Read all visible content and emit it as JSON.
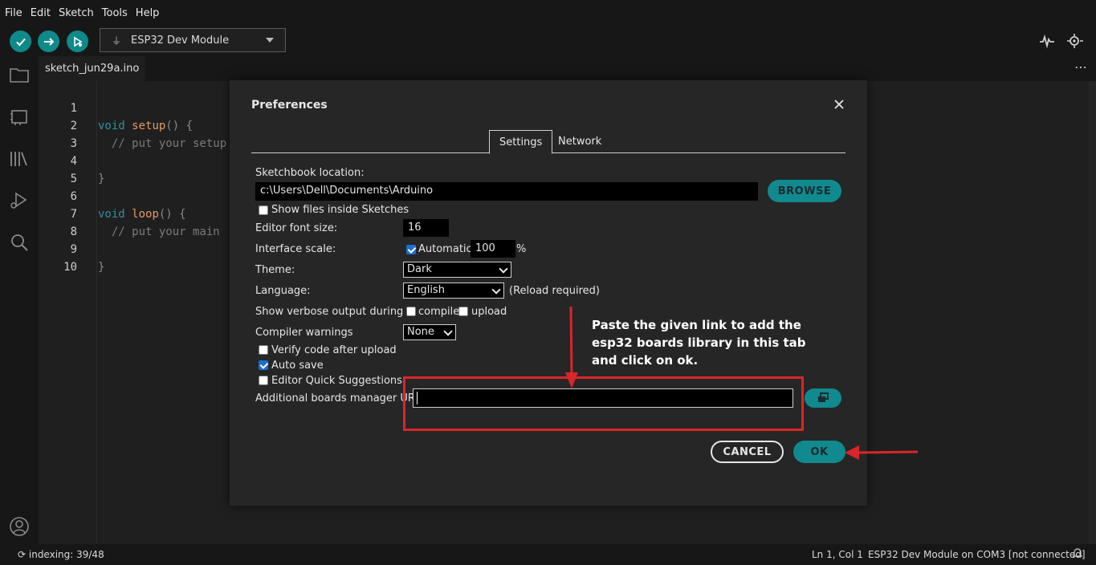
{
  "menu": [
    "File",
    "Edit",
    "Sketch",
    "Tools",
    "Help"
  ],
  "toolbar": {
    "board": "ESP32 Dev Module"
  },
  "file_tab": "sketch_jun29a.ino",
  "code": [
    {
      "n": "1",
      "kw": "void",
      "fn": "setup",
      "rest": "() {",
      "cm": ""
    },
    {
      "n": "2",
      "kw": "",
      "fn": "",
      "rest": "",
      "cm": "  // put your setup"
    },
    {
      "n": "3",
      "kw": "",
      "fn": "",
      "rest": "",
      "cm": ""
    },
    {
      "n": "4",
      "kw": "",
      "fn": "",
      "rest": "}",
      "cm": ""
    },
    {
      "n": "5",
      "kw": "",
      "fn": "",
      "rest": "",
      "cm": ""
    },
    {
      "n": "6",
      "kw": "void",
      "fn": "loop",
      "rest": "() {",
      "cm": ""
    },
    {
      "n": "7",
      "kw": "",
      "fn": "",
      "rest": "",
      "cm": "  // put your main"
    },
    {
      "n": "8",
      "kw": "",
      "fn": "",
      "rest": "",
      "cm": ""
    },
    {
      "n": "9",
      "kw": "",
      "fn": "",
      "rest": "}",
      "cm": ""
    },
    {
      "n": "10",
      "kw": "",
      "fn": "",
      "rest": "",
      "cm": ""
    }
  ],
  "dialog": {
    "title": "Preferences",
    "tabs": {
      "settings": "Settings",
      "network": "Network"
    },
    "sketchbook_label": "Sketchbook location:",
    "sketchbook_value": "c:\\Users\\Dell\\Documents\\Arduino",
    "browse": "BROWSE",
    "show_files": "Show files inside Sketches",
    "font_size_label": "Editor font size:",
    "font_size_value": "16",
    "scale_label": "Interface scale:",
    "scale_auto": "Automatic",
    "scale_value": "100",
    "scale_unit": "%",
    "theme_label": "Theme:",
    "theme_value": "Dark",
    "language_label": "Language:",
    "language_value": "English",
    "reload_note": "(Reload required)",
    "verbose_label": "Show verbose output during",
    "verbose_compile": "compile",
    "verbose_upload": "upload",
    "warnings_label": "Compiler warnings",
    "warnings_value": "None",
    "verify_after_upload": "Verify code after upload",
    "auto_save": "Auto save",
    "quick_suggestions": "Editor Quick Suggestions",
    "boards_url_label": "Additional boards manager URLs:",
    "boards_url_value": "",
    "cancel": "CANCEL",
    "ok": "OK"
  },
  "annotation": "Paste the given link to add the esp32 boards library in this tab and click on ok.",
  "status": {
    "indexing": "indexing: 39/48",
    "position": "Ln 1, Col 1",
    "board": "ESP32 Dev Module on COM3 [not connected]"
  },
  "colors": {
    "accent": "#108a8f",
    "annotation_red": "#d9262a"
  }
}
